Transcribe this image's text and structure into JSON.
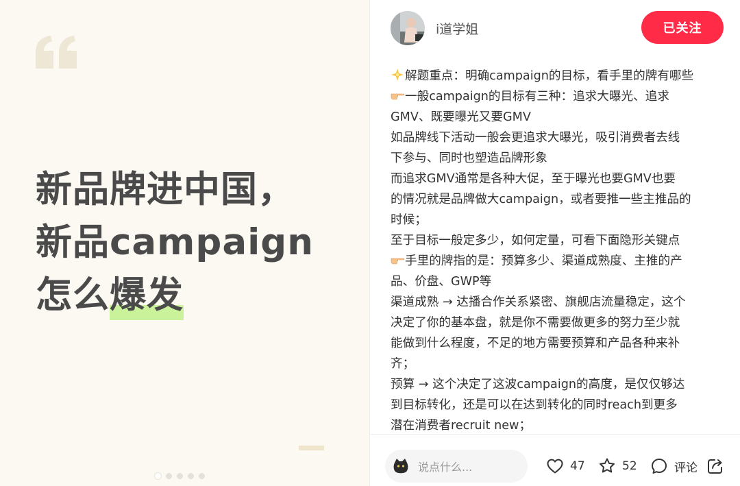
{
  "slide": {
    "title_line1": "新品牌进中国，",
    "title_line2": "新品campaign",
    "title_line3_plain": "怎么",
    "title_line3_highlight": "爆发",
    "pager_count": 5,
    "active_page": 1
  },
  "author": {
    "name": "i道学姐",
    "follow_label": "已关注"
  },
  "post": {
    "lines": [
      {
        "icon": "sparkle-star-icon",
        "text": "解题重点：明确campaign的目标，看手里的牌有哪些"
      },
      {
        "icon": "pointing-hand-icon",
        "text": "一般campaign的目标有三种：追求大曝光、追求"
      },
      {
        "icon": "",
        "text": "GMV、既要曝光又要GMV"
      },
      {
        "icon": "",
        "text": "如品牌线下活动一般会更追求大曝光，吸引消费者去线"
      },
      {
        "icon": "",
        "text": "下参与、同时也塑造品牌形象"
      },
      {
        "icon": "",
        "text": "而追求GMV通常是各种大促，至于曝光也要GMV也要"
      },
      {
        "icon": "",
        "text": "的情况就是品牌做大campaign，或者要推一些主推品的"
      },
      {
        "icon": "",
        "text": "时候；"
      },
      {
        "icon": "",
        "text": "至于目标一般定多少，如何定量，可看下面隐形关键点"
      },
      {
        "icon": "pointing-hand-icon",
        "text": "手里的牌指的是：预算多少、渠道成熟度、主推的产"
      },
      {
        "icon": "",
        "text": "品、价盘、GWP等"
      },
      {
        "icon": "",
        "text": "渠道成熟 → 达播合作关系紧密、旗舰店流量稳定，这个"
      },
      {
        "icon": "",
        "text": "决定了你的基本盘，就是你不需要做更多的努力至少就"
      },
      {
        "icon": "",
        "text": "能做到什么程度，不足的地方需要预算和产品各种来补"
      },
      {
        "icon": "",
        "text": "齐；"
      },
      {
        "icon": "",
        "text": "预算 → 这个决定了这波campaign的高度，是仅仅够达"
      },
      {
        "icon": "",
        "text": "到目标转化，还是可以在达到转化的同时reach到更多"
      },
      {
        "icon": "",
        "text": "潜在消费者recruit new；"
      }
    ]
  },
  "bottom_bar": {
    "comment_placeholder": "说点什么...",
    "likes": "47",
    "favorites": "52",
    "comment_label": "评论"
  },
  "colors": {
    "follow_button": "#ff2b47",
    "highlight": "#c9f29a",
    "slide_background": "#fbf9f1",
    "title_text": "#4a4a4a"
  }
}
